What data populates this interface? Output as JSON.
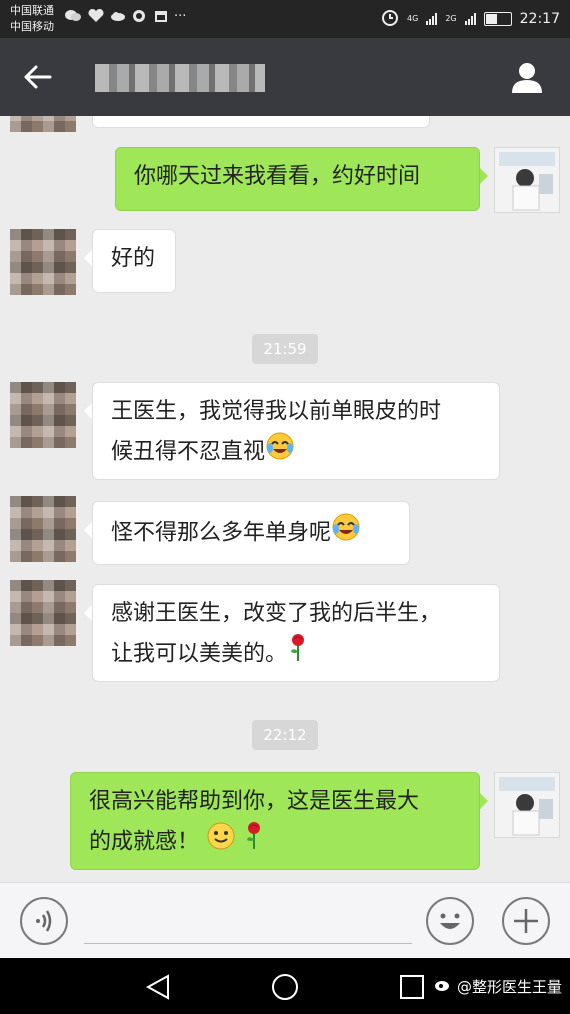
{
  "status_bar": {
    "carrier1": "中国联通",
    "carrier2": "中国移动",
    "net1": "4G",
    "net2": "2G",
    "battery_level": 0.45,
    "time": "22:17"
  },
  "title_bar": {
    "back_icon": "arrow-left-icon",
    "profile_icon": "person-icon"
  },
  "messages": [
    {
      "side": "out",
      "text": "你哪天过来我看看，约好时间"
    },
    {
      "side": "in",
      "text": "好的"
    },
    {
      "timestamp": "21:59"
    },
    {
      "side": "in",
      "line1": "王医生，我觉得我以前单眼皮的时",
      "line2": "候丑得不忍直视"
    },
    {
      "side": "in",
      "text": "怪不得那么多年单身呢"
    },
    {
      "side": "in",
      "line1": "感谢王医生，改变了我的后半生，",
      "line2": "让我可以美美的。"
    },
    {
      "timestamp": "22:12"
    },
    {
      "side": "out",
      "line1": "很高兴能帮助到你，这是医生最大",
      "line2": "的成就感！"
    }
  ],
  "emojis": {
    "laugh_cry": "laugh-cry-emoji",
    "smile": "smile-emoji",
    "rose": "rose-emoji"
  },
  "input_bar": {
    "voice_icon": "voice-icon",
    "emoji_icon": "emoji-icon",
    "plus_icon": "plus-icon"
  },
  "watermark": "@整形医生王量",
  "colors": {
    "titlebar": "#393a3f",
    "outgoing_bubble": "#9fe658",
    "incoming_bubble": "#ffffff",
    "chat_bg": "#ececec"
  }
}
